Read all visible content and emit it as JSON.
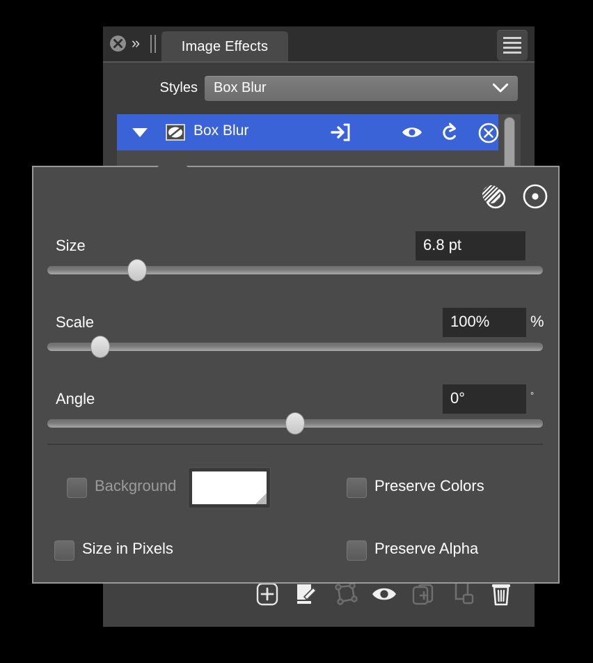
{
  "window": {
    "titlebar": {
      "close_icon": "close-circle-icon",
      "expand_icon": "double-chevron-right-icon",
      "divider_icon": "grip-divider-icon",
      "menu_icon": "hamburger-menu-icon",
      "tab_label": "Image Effects"
    },
    "styles": {
      "label": "Styles",
      "value": "Box Blur",
      "dropdown_icon": "chevron-down-icon"
    },
    "layers": [
      {
        "name": "Box Blur",
        "expanded": true,
        "selected": true,
        "toggle_icon": "triangle-down-icon",
        "thumbnail_icon": "effect-thumbnail-icon",
        "actions": [
          "arrow-into-box-icon",
          "eye-visibility-icon",
          "reset-icon",
          "close-circle-icon"
        ]
      }
    ],
    "scrollbar_icon": "vertical-scrollbar-thumb",
    "bottom_toolbar": [
      {
        "icon": "add-effect-icon",
        "enabled": true
      },
      {
        "icon": "edit-pencil-icon",
        "enabled": true
      },
      {
        "icon": "shape-nodes-icon",
        "enabled": false
      },
      {
        "icon": "eye-visibility-icon",
        "enabled": true
      },
      {
        "icon": "duplicate-icon",
        "enabled": false
      },
      {
        "icon": "nest-group-icon",
        "enabled": false
      },
      {
        "icon": "trash-delete-icon",
        "enabled": true
      }
    ]
  },
  "popup": {
    "header_icons": [
      {
        "name": "striped-circle-icon"
      },
      {
        "name": "dot-circle-icon"
      }
    ],
    "sliders": [
      {
        "label": "Size",
        "value": "6.8 pt",
        "suffix": "",
        "percent": 18
      },
      {
        "label": "Scale",
        "value": "100%",
        "suffix": "%",
        "percent": 11
      },
      {
        "label": "Angle",
        "value": "0°",
        "suffix": "°",
        "percent": 50
      }
    ],
    "checkboxes": [
      {
        "label": "Background",
        "checked": false,
        "disabled": true
      },
      {
        "label": "Preserve Colors",
        "checked": false,
        "disabled": false
      },
      {
        "label": "Size in Pixels",
        "checked": false,
        "disabled": false
      },
      {
        "label": "Preserve Alpha",
        "checked": false,
        "disabled": false
      }
    ],
    "background_color": "#ffffff",
    "color_swatch_icon": "color-swatch-icon"
  },
  "colors": {
    "selection_blue": "#3a63d8",
    "panel_gray": "#4a4a4a",
    "window_gray": "#3c3c3c",
    "field_dark": "#2b2b2b",
    "page_background": "#000000"
  }
}
